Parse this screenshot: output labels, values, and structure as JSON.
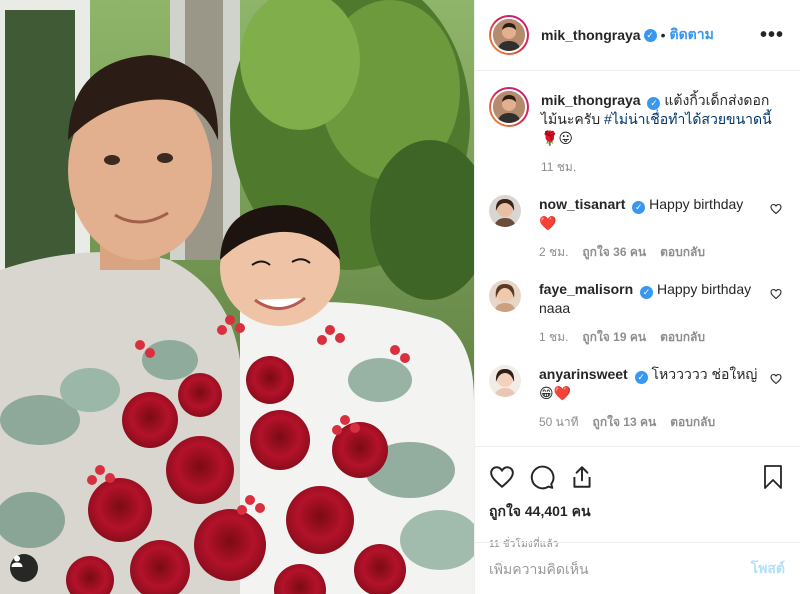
{
  "post": {
    "author": {
      "username": "mik_thongraya",
      "verified": true
    },
    "follow_label": "ติดตาม",
    "more_label": "•••",
    "caption": {
      "username": "mik_thongraya",
      "text": "แต้งกิ้วเด็กส่งดอกไม้นะครับ",
      "hashtag": "#ไม่น่าเชื่อทำได้สวยขนาดนี้",
      "emoji": "🌹😛",
      "time": "11 ชม."
    },
    "comments": [
      {
        "username": "now_tisanart",
        "text": "Happy birthday",
        "emoji": "❤️",
        "time": "2 ชม.",
        "likes": "ถูกใจ 36 คน",
        "reply_label": "ตอบกลับ"
      },
      {
        "username": "faye_malisorn",
        "text": "Happy birthday naaa",
        "emoji": "",
        "time": "1 ชม.",
        "likes": "ถูกใจ 19 คน",
        "reply_label": "ตอบกลับ"
      },
      {
        "username": "anyarinsweet",
        "text": "โหววววว ช่อใหญ่",
        "emoji": "😁❤️",
        "time": "50 นาที",
        "likes": "ถูกใจ 13 คน",
        "reply_label": "ตอบกลับ"
      }
    ],
    "likes_count": "ถูกใจ 44,401 คน",
    "timestamp": "11 ชั่วโมงที่แล้ว",
    "add_comment_placeholder": "เพิ่มความคิดเห็น",
    "post_button": "โพสต์"
  },
  "colors": {
    "link": "#3897f0",
    "verified": "#3897f0",
    "hashtag": "#003569",
    "muted": "#8e8e8e",
    "post_disabled": "#b2dffc"
  },
  "icons": [
    "verified-badge-icon",
    "more-options-icon",
    "heart-icon",
    "comment-icon",
    "share-icon",
    "bookmark-icon",
    "user-tag-icon"
  ]
}
